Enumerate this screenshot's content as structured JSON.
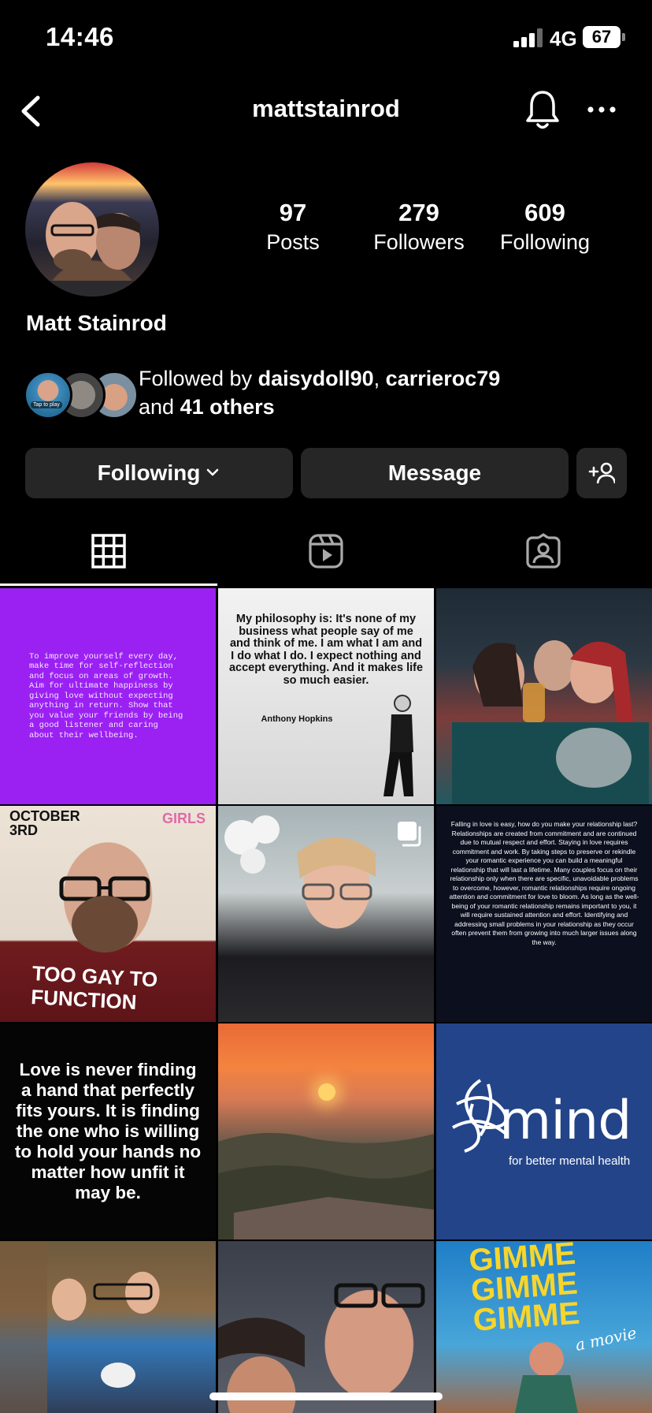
{
  "status_bar": {
    "time": "14:46",
    "network": "4G",
    "battery": "67"
  },
  "header": {
    "username": "mattstainrod"
  },
  "profile": {
    "display_name": "Matt Stainrod",
    "stats": [
      {
        "value": "97",
        "label": "Posts"
      },
      {
        "value": "279",
        "label": "Followers"
      },
      {
        "value": "609",
        "label": "Following"
      }
    ],
    "followed_by": {
      "prefix": "Followed by ",
      "name1": "daisydoll90",
      "sep": ", ",
      "name2": "carrieroc79",
      "and": "and ",
      "others": "41 others",
      "tap_to_play": "Tap to play"
    }
  },
  "actions": {
    "following_label": "Following",
    "message_label": "Message"
  },
  "posts": {
    "purple_text": "To improve yourself every day, make time for self-reflection and focus on areas of growth. Aim for ultimate happiness by giving love without expecting anything in return. Show that you value your friends by being a good listener and caring about their wellbeing.",
    "philosophy_text": "My philosophy is: It's none of my business what people say of me and think of me. I am what I am and I do what I do. I expect nothing and accept everything. And it makes life so much easier.",
    "philosophy_author": "Anthony Hopkins",
    "shirt_text": "TOO GAY TO FUNCTION",
    "date_text": "OCTOBER 3RD",
    "girls_text": "GIRLS",
    "relationship_text": "Falling in love is easy, how do you make your relationship last? Relationships are created from commitment and are continued due to mutual respect and effort. Staying in love requires commitment and work. By taking steps to preserve or rekindle your romantic experience you can build a meaningful relationship that will last a lifetime. Many couples focus on their relationship only when there are specific, unavoidable problems to overcome, however, romantic relationships require ongoing attention and commitment for love to bloom. As long as the well-being of your romantic relationship remains important to you, it will require sustained attention and effort. Identifying and addressing small problems in your relationship as they occur often prevent them from growing into much larger issues along the way.",
    "love_quote": "Love is never finding a hand that perfectly fits yours. It is finding the one who is willing to hold your hands no matter how unfit it may be.",
    "mind_word": "mind",
    "mind_tagline": "for better mental health",
    "gimme_title": "GIMME GIMME GIMME",
    "gimme_sub": "a movie"
  }
}
